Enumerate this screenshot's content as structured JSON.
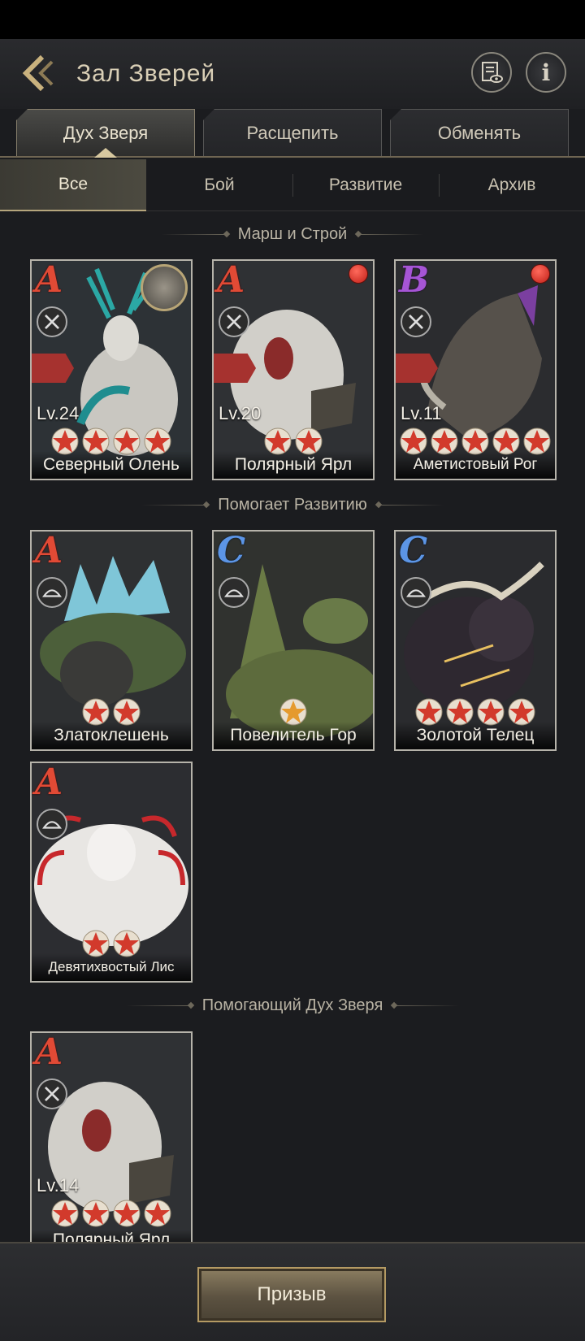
{
  "header": {
    "title": "Зал Зверей"
  },
  "tabs": [
    {
      "label": "Дух Зверя",
      "active": true
    },
    {
      "label": "Расщепить",
      "active": false
    },
    {
      "label": "Обменять",
      "active": false
    }
  ],
  "subtabs": [
    {
      "label": "Все",
      "active": true
    },
    {
      "label": "Бой",
      "active": false
    },
    {
      "label": "Развитие",
      "active": false
    },
    {
      "label": "Архив",
      "active": false
    }
  ],
  "sections": [
    {
      "title": "Марш и Строй",
      "cards": [
        {
          "rank": "A",
          "level": "Lv.24",
          "stars": 4,
          "name": "Северный Олень",
          "red_dot": false,
          "portrait_badge": true,
          "role_badge": "squad-icon"
        },
        {
          "rank": "A",
          "level": "Lv.20",
          "stars": 2,
          "name": "Полярный Ярл",
          "red_dot": true,
          "portrait_badge": false,
          "role_badge": "squad-icon"
        },
        {
          "rank": "B",
          "level": "Lv.11",
          "stars": 5,
          "name": "Аметистовый Рог",
          "red_dot": true,
          "portrait_badge": false,
          "role_badge": "flag-icon"
        }
      ]
    },
    {
      "title": "Помогает Развитию",
      "cards": [
        {
          "rank": "A",
          "level": "",
          "stars": 2,
          "name": "Златоклешень",
          "red_dot": false
        },
        {
          "rank": "C",
          "level": "",
          "stars": 1,
          "name": "Повелитель Гор",
          "red_dot": false
        },
        {
          "rank": "C",
          "level": "",
          "stars": 4,
          "name": "Золотой Телец",
          "red_dot": false
        },
        {
          "rank": "A",
          "level": "",
          "stars": 2,
          "name": "Девятихвостый Лис",
          "red_dot": false
        }
      ]
    },
    {
      "title": "Помогающий Дух Зверя",
      "cards": [
        {
          "rank": "A",
          "level": "Lv.14",
          "stars": 4,
          "name": "Полярный Ярл",
          "red_dot": false
        }
      ]
    }
  ],
  "footer": {
    "summon_label": "Призыв"
  },
  "colors": {
    "accent_gold": "#b49a63",
    "rank_a": "#e14a35",
    "rank_b": "#a655d6",
    "rank_c": "#5c95e6",
    "red_dot": "#d2281e"
  }
}
